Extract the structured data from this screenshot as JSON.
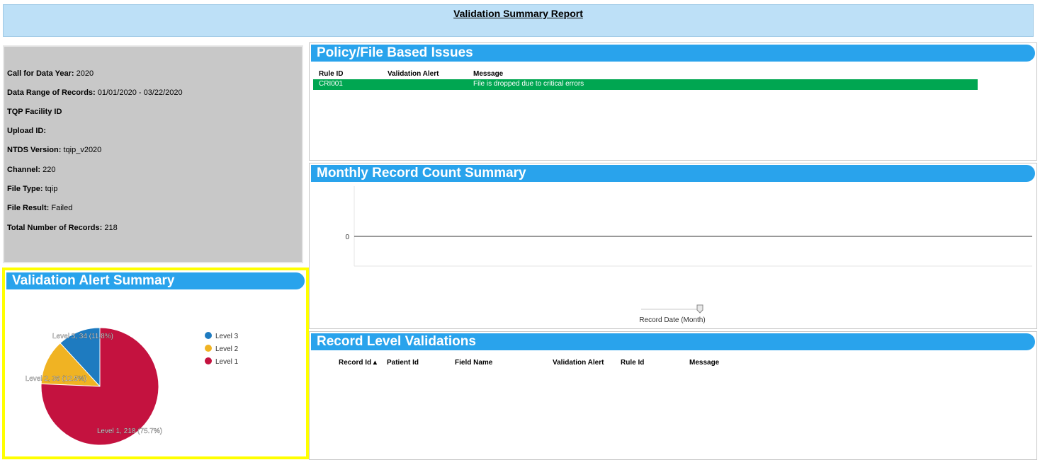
{
  "header": {
    "title": "Validation Summary Report"
  },
  "info": [
    {
      "label": "Call for Data Year:",
      "value": "2020"
    },
    {
      "label": "Data Range of Records:",
      "value": "01/01/2020 - 03/22/2020"
    },
    {
      "label": "TQP Facility ID",
      "value": ""
    },
    {
      "label": "Upload ID:",
      "value": ""
    },
    {
      "label": "NTDS Version:",
      "value": "tqip_v2020"
    },
    {
      "label": "Channel:",
      "value": "220"
    },
    {
      "label": "File Type:",
      "value": "tqip"
    },
    {
      "label": "File Result:",
      "value": "Failed"
    },
    {
      "label": "Total Number of Records:",
      "value": "218"
    }
  ],
  "policy": {
    "title": "Policy/File Based Issues",
    "columns": [
      "Rule ID",
      "Validation Alert",
      "Message"
    ],
    "rows": [
      {
        "rule_id": "CRI001",
        "alert": "",
        "message": "File is dropped due to critical errors",
        "color": "#00a651"
      }
    ]
  },
  "monthly": {
    "title": "Monthly Record Count Summary",
    "y_tick": "0",
    "x_label": "Record Date (Month)"
  },
  "records": {
    "title": "Record Level Validations",
    "columns": [
      "Record Id ▴",
      "Patient Id",
      "Field Name",
      "Validation Alert",
      "Rule Id",
      "Message"
    ]
  },
  "alerts": {
    "title": "Validation Alert Summary",
    "legend": [
      "Level 3",
      "Level 2",
      "Level 1"
    ],
    "labels": [
      "Level 3, 34 (11.8%)",
      "Level 2, 36 (12.5%)",
      "Level 1, 218 (75.7%)"
    ]
  },
  "chart_data": {
    "type": "pie",
    "categories": [
      "Level 3",
      "Level 2",
      "Level 1"
    ],
    "values": [
      34,
      36,
      218
    ],
    "percents": [
      11.8,
      12.5,
      75.7
    ],
    "colors": [
      "#1e7bc0",
      "#f0b323",
      "#c4123f"
    ],
    "legend": "right"
  }
}
